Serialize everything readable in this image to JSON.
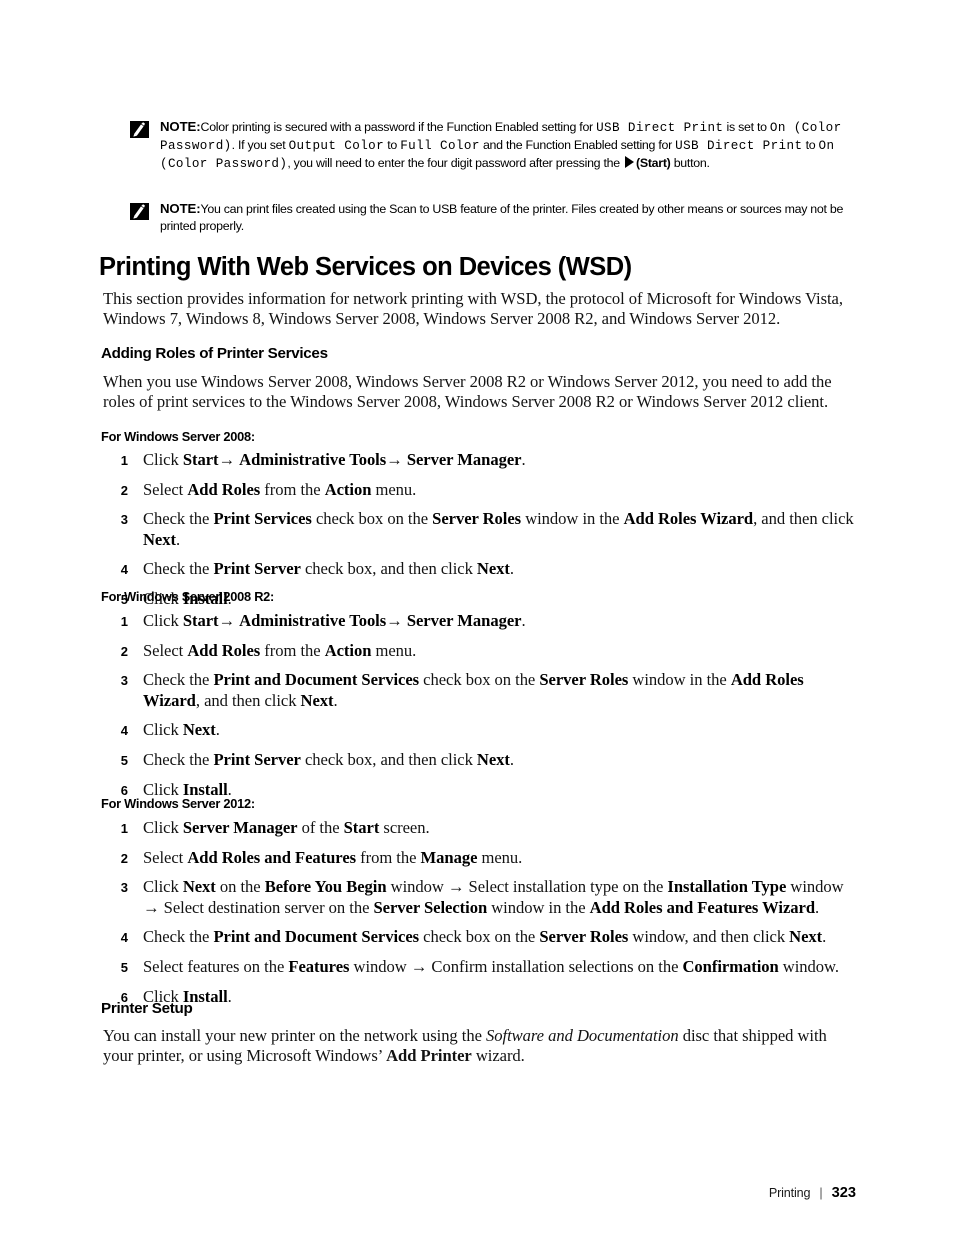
{
  "document": {
    "notes": [
      {
        "icon": "note-pencil-icon",
        "label": "NOTE:",
        "segments": [
          {
            "t": "Color printing is secured with a password if the Function Enabled setting for ",
            "s": "normal"
          },
          {
            "t": "USB Direct Print",
            "s": "mono"
          },
          {
            "t": " is set to ",
            "s": "normal"
          },
          {
            "t": "On (Color Password)",
            "s": "mono"
          },
          {
            "t": ". If you set ",
            "s": "normal"
          },
          {
            "t": "Output Color",
            "s": "mono"
          },
          {
            "t": " to ",
            "s": "normal"
          },
          {
            "t": "Full Color",
            "s": "mono"
          },
          {
            "t": " and the Function Enabled setting for ",
            "s": "normal"
          },
          {
            "t": "USB Direct Print",
            "s": "mono"
          },
          {
            "t": " to ",
            "s": "normal"
          },
          {
            "t": "On (Color Password)",
            "s": "mono"
          },
          {
            "t": ", you will need to enter the four digit password after pressing the ",
            "s": "normal"
          },
          {
            "t": "START_TRIANGLE",
            "s": "icon"
          },
          {
            "t": "(Start)",
            "s": "bold"
          },
          {
            "t": " button.",
            "s": "normal"
          }
        ]
      },
      {
        "icon": "note-pencil-icon",
        "label": "NOTE:",
        "segments": [
          {
            "t": "You can print files created using the Scan to USB feature of the printer. Files created by other means or sources may not be printed properly.",
            "s": "normal"
          }
        ]
      }
    ],
    "heading_main": "Printing With Web Services on Devices (WSD)",
    "intro_paragraph": "This section provides information for network printing with WSD, the protocol of Microsoft for Windows Vista, Windows 7, Windows 8, Windows Server 2008, Windows Server 2008 R2, and Windows Server 2012.",
    "section_adding_roles": {
      "heading": "Adding Roles of Printer Services",
      "paragraph": "When you use Windows Server 2008, Windows Server 2008 R2 or Windows Server 2012, you need to add the roles of print services to the Windows Server 2008, Windows Server 2008 R2 or Windows Server 2012 client."
    },
    "server2008": {
      "heading": "For Windows Server 2008:",
      "steps": [
        {
          "num": "1",
          "segments": [
            {
              "t": "Click ",
              "s": "normal"
            },
            {
              "t": "Start",
              "s": "bold"
            },
            {
              "t": "→ ",
              "s": "normal"
            },
            {
              "t": "Administrative Tools",
              "s": "bold"
            },
            {
              "t": "→ ",
              "s": "normal"
            },
            {
              "t": "Server Manager",
              "s": "bold"
            },
            {
              "t": ".",
              "s": "normal"
            }
          ]
        },
        {
          "num": "2",
          "segments": [
            {
              "t": "Select ",
              "s": "normal"
            },
            {
              "t": "Add Roles",
              "s": "bold"
            },
            {
              "t": " from the ",
              "s": "normal"
            },
            {
              "t": "Action",
              "s": "bold"
            },
            {
              "t": " menu.",
              "s": "normal"
            }
          ]
        },
        {
          "num": "3",
          "segments": [
            {
              "t": "Check the ",
              "s": "normal"
            },
            {
              "t": "Print Services",
              "s": "bold"
            },
            {
              "t": " check box on the ",
              "s": "normal"
            },
            {
              "t": "Server Roles",
              "s": "bold"
            },
            {
              "t": " window in the ",
              "s": "normal"
            },
            {
              "t": "Add Roles Wizard",
              "s": "bold"
            },
            {
              "t": ", and then click ",
              "s": "normal"
            },
            {
              "t": "Next",
              "s": "bold"
            },
            {
              "t": ".",
              "s": "normal"
            }
          ]
        },
        {
          "num": "4",
          "segments": [
            {
              "t": "Check the ",
              "s": "normal"
            },
            {
              "t": "Print Server",
              "s": "bold"
            },
            {
              "t": " check box, and then click ",
              "s": "normal"
            },
            {
              "t": "Next",
              "s": "bold"
            },
            {
              "t": ".",
              "s": "normal"
            }
          ]
        },
        {
          "num": "5",
          "segments": [
            {
              "t": "Click ",
              "s": "normal"
            },
            {
              "t": "Install",
              "s": "bold"
            },
            {
              "t": ".",
              "s": "normal"
            }
          ]
        }
      ]
    },
    "server2008r2": {
      "heading": "For Windows Server 2008 R2:",
      "steps": [
        {
          "num": "1",
          "segments": [
            {
              "t": "Click ",
              "s": "normal"
            },
            {
              "t": "Start",
              "s": "bold"
            },
            {
              "t": "→ ",
              "s": "normal"
            },
            {
              "t": "Administrative Tools",
              "s": "bold"
            },
            {
              "t": "→ ",
              "s": "normal"
            },
            {
              "t": "Server Manager",
              "s": "bold"
            },
            {
              "t": ".",
              "s": "normal"
            }
          ]
        },
        {
          "num": "2",
          "segments": [
            {
              "t": "Select ",
              "s": "normal"
            },
            {
              "t": "Add Roles",
              "s": "bold"
            },
            {
              "t": " from the ",
              "s": "normal"
            },
            {
              "t": "Action",
              "s": "bold"
            },
            {
              "t": " menu.",
              "s": "normal"
            }
          ]
        },
        {
          "num": "3",
          "segments": [
            {
              "t": "Check the ",
              "s": "normal"
            },
            {
              "t": "Print and Document Services",
              "s": "bold"
            },
            {
              "t": " check box on the ",
              "s": "normal"
            },
            {
              "t": "Server Roles",
              "s": "bold"
            },
            {
              "t": " window in the ",
              "s": "normal"
            },
            {
              "t": "Add Roles Wizard",
              "s": "bold"
            },
            {
              "t": ", and then click ",
              "s": "normal"
            },
            {
              "t": "Next",
              "s": "bold"
            },
            {
              "t": ".",
              "s": "normal"
            }
          ]
        },
        {
          "num": "4",
          "segments": [
            {
              "t": "Click ",
              "s": "normal"
            },
            {
              "t": "Next",
              "s": "bold"
            },
            {
              "t": ".",
              "s": "normal"
            }
          ]
        },
        {
          "num": "5",
          "segments": [
            {
              "t": "Check the ",
              "s": "normal"
            },
            {
              "t": "Print Server",
              "s": "bold"
            },
            {
              "t": " check box, and then click ",
              "s": "normal"
            },
            {
              "t": "Next",
              "s": "bold"
            },
            {
              "t": ".",
              "s": "normal"
            }
          ]
        },
        {
          "num": "6",
          "segments": [
            {
              "t": "Click ",
              "s": "normal"
            },
            {
              "t": "Install",
              "s": "bold"
            },
            {
              "t": ".",
              "s": "normal"
            }
          ]
        }
      ]
    },
    "server2012": {
      "heading": "For Windows Server 2012:",
      "steps": [
        {
          "num": "1",
          "segments": [
            {
              "t": "Click ",
              "s": "normal"
            },
            {
              "t": "Server Manager",
              "s": "bold"
            },
            {
              "t": " of the ",
              "s": "normal"
            },
            {
              "t": "Start",
              "s": "bold"
            },
            {
              "t": " screen.",
              "s": "normal"
            }
          ]
        },
        {
          "num": "2",
          "segments": [
            {
              "t": "Select ",
              "s": "normal"
            },
            {
              "t": "Add Roles and Features",
              "s": "bold"
            },
            {
              "t": " from the ",
              "s": "normal"
            },
            {
              "t": "Manage",
              "s": "bold"
            },
            {
              "t": " menu.",
              "s": "normal"
            }
          ]
        },
        {
          "num": "3",
          "segments": [
            {
              "t": "Click ",
              "s": "normal"
            },
            {
              "t": "Next",
              "s": "bold"
            },
            {
              "t": " on the ",
              "s": "normal"
            },
            {
              "t": "Before You Begin",
              "s": "bold"
            },
            {
              "t": " window → Select installation type on the ",
              "s": "normal"
            },
            {
              "t": "Installation Type",
              "s": "bold"
            },
            {
              "t": " window → Select destination server on the ",
              "s": "normal"
            },
            {
              "t": "Server Selection",
              "s": "bold"
            },
            {
              "t": " window in the ",
              "s": "normal"
            },
            {
              "t": "Add Roles and Features Wizard",
              "s": "bold"
            },
            {
              "t": ".",
              "s": "normal"
            }
          ]
        },
        {
          "num": "4",
          "segments": [
            {
              "t": "Check the ",
              "s": "normal"
            },
            {
              "t": "Print and Document Services",
              "s": "bold"
            },
            {
              "t": " check box on the ",
              "s": "normal"
            },
            {
              "t": "Server Roles",
              "s": "bold"
            },
            {
              "t": " window, and then click ",
              "s": "normal"
            },
            {
              "t": "Next",
              "s": "bold"
            },
            {
              "t": ".",
              "s": "normal"
            }
          ]
        },
        {
          "num": "5",
          "segments": [
            {
              "t": "Select features on the ",
              "s": "normal"
            },
            {
              "t": "Features",
              "s": "bold"
            },
            {
              "t": " window → Confirm installation selections on the ",
              "s": "normal"
            },
            {
              "t": "Confirmation",
              "s": "bold"
            },
            {
              "t": " window.",
              "s": "normal"
            }
          ]
        },
        {
          "num": "6",
          "segments": [
            {
              "t": "Click ",
              "s": "normal"
            },
            {
              "t": "Install",
              "s": "bold"
            },
            {
              "t": ".",
              "s": "normal"
            }
          ]
        }
      ]
    },
    "section_printer_setup": {
      "heading": "Printer Setup",
      "segments": [
        {
          "t": "You can install your new printer on the network using the ",
          "s": "normal"
        },
        {
          "t": "Software and Documentation",
          "s": "italic"
        },
        {
          "t": " disc that shipped with your printer, or using Microsoft Windows’ ",
          "s": "normal"
        },
        {
          "t": "Add Printer",
          "s": "bold"
        },
        {
          "t": " wizard.",
          "s": "normal"
        }
      ]
    },
    "footer": {
      "label": "Printing",
      "separator": "|",
      "page_number": "323"
    }
  }
}
